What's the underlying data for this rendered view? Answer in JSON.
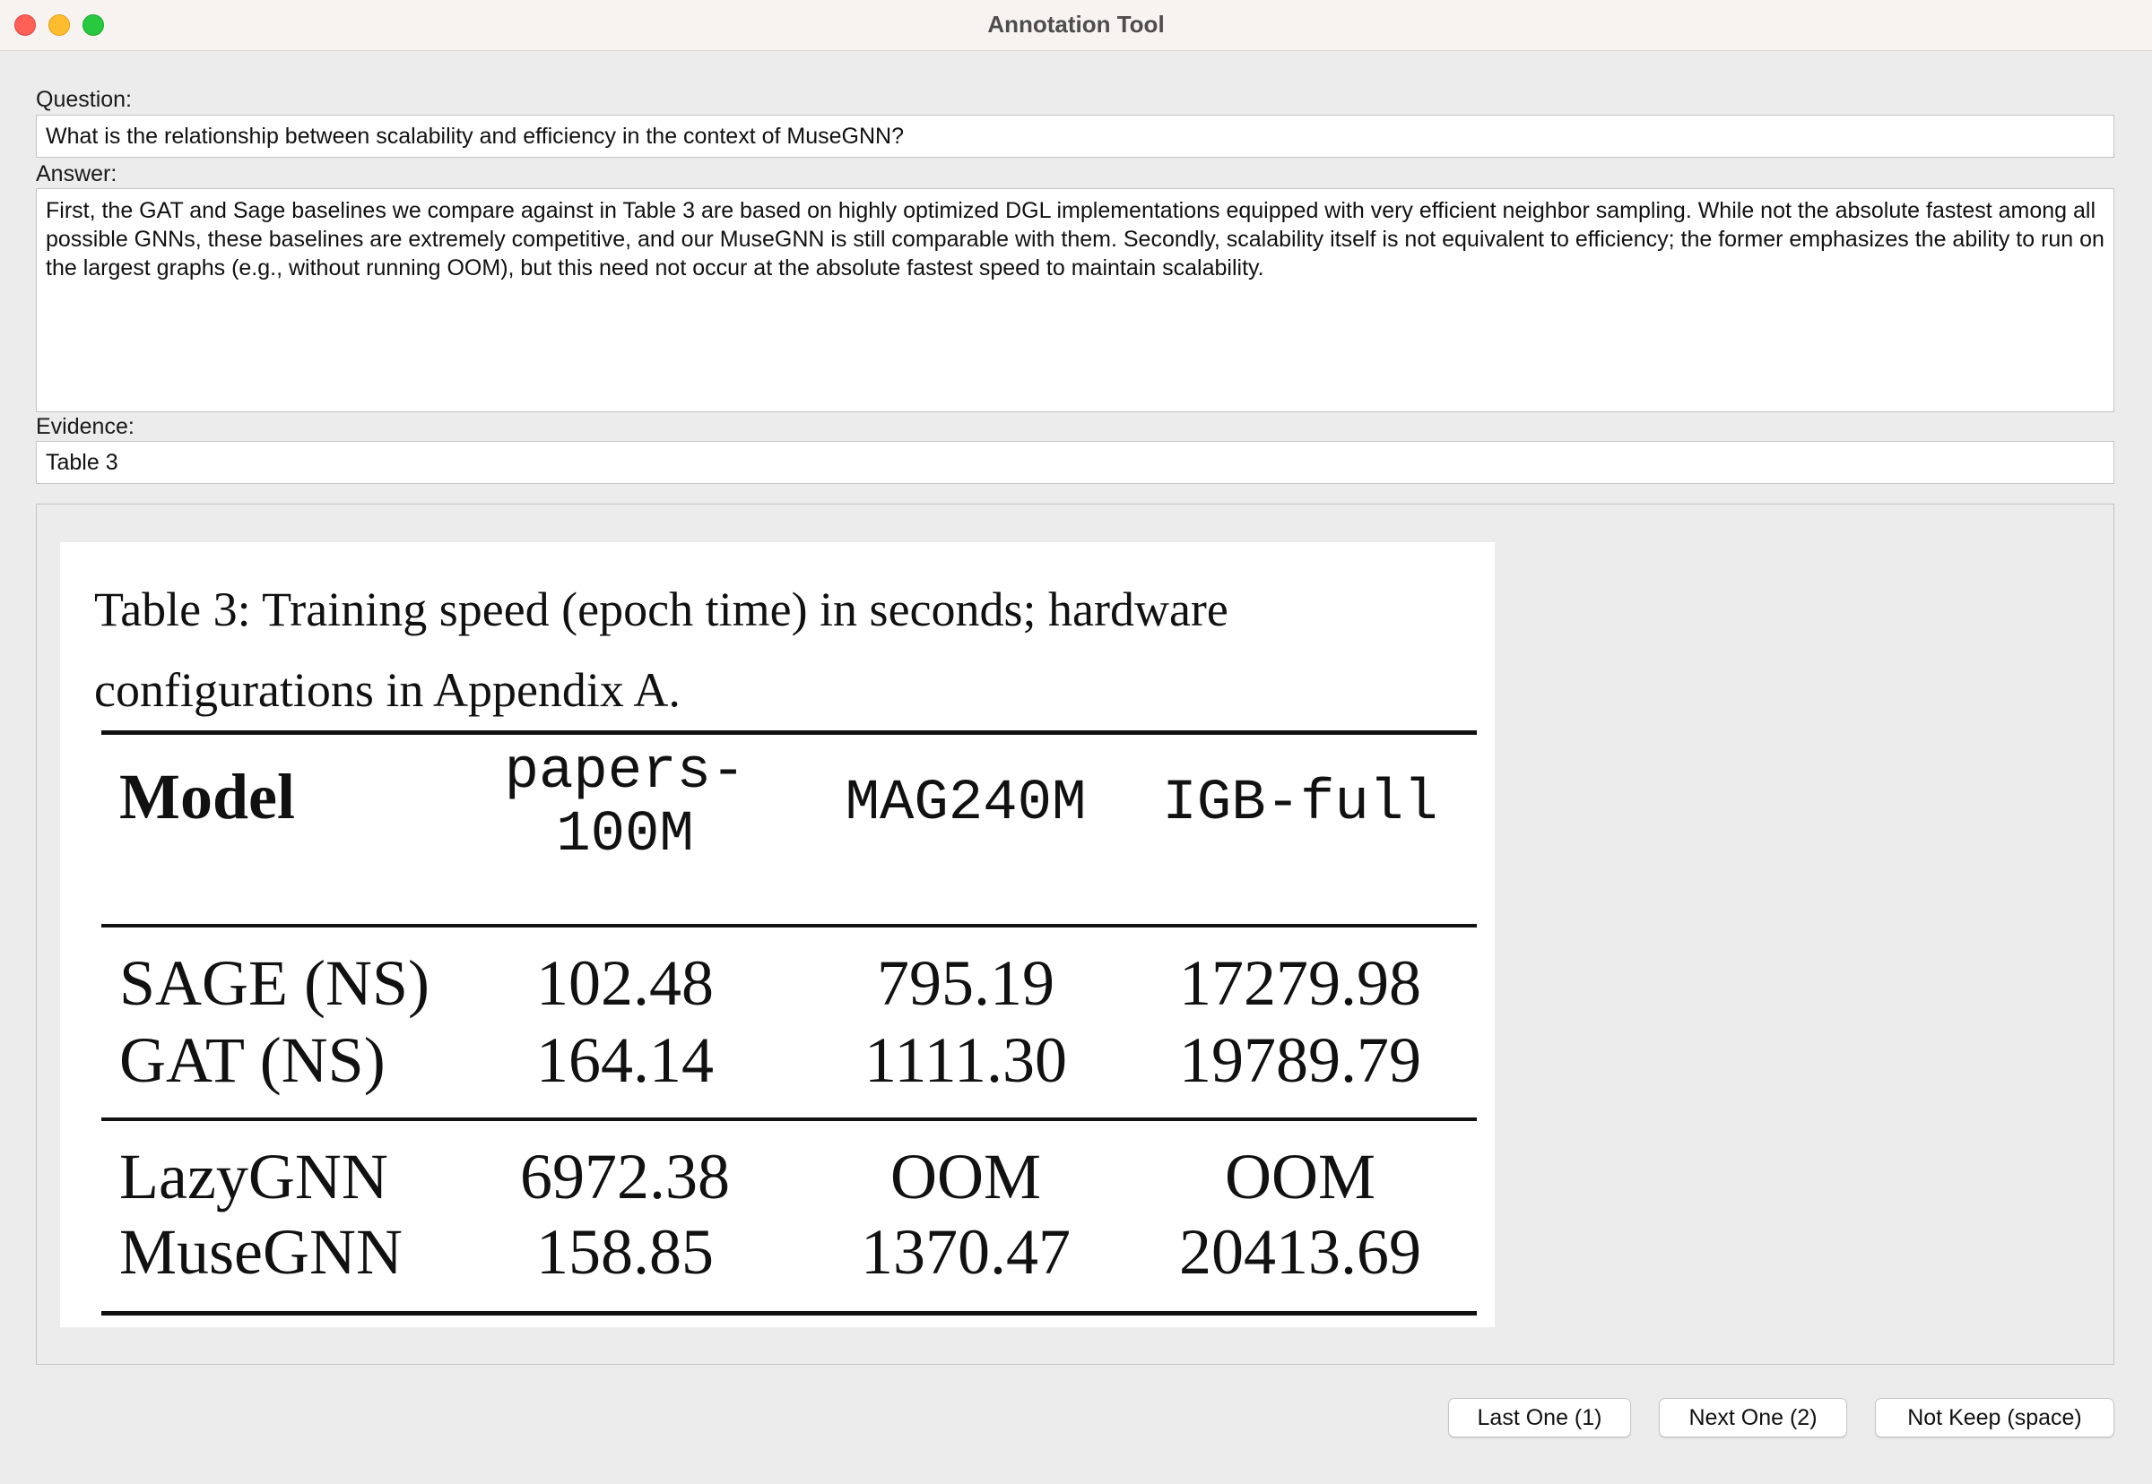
{
  "window": {
    "title": "Annotation Tool"
  },
  "form": {
    "question_label": "Question:",
    "question_value": "What is the relationship between scalability and efficiency in the context of MuseGNN?",
    "answer_label": "Answer:",
    "answer_value": "First, the GAT and Sage baselines we compare against in Table 3 are based on highly optimized DGL implementations equipped with very efficient neighbor sampling. While not the absolute fastest among all possible GNNs, these baselines are extremely competitive, and our MuseGNN is still comparable with them. Secondly, scalability itself is not equivalent to efficiency; the former emphasizes the ability to run on the largest graphs (e.g., without running OOM), but this need not occur at the absolute fastest speed to maintain scalability.",
    "evidence_label": "Evidence:",
    "evidence_value": "Table 3"
  },
  "evidence_image": {
    "caption_line1": "Table 3: Training speed (epoch time) in seconds; hardware",
    "caption_line2": "configurations in Appendix A.",
    "columns": [
      "Model",
      "papers-",
      "100M",
      "MAG240M",
      "IGB-full"
    ],
    "rows": [
      [
        "SAGE (NS)",
        "102.48",
        "795.19",
        "17279.98"
      ],
      [
        "GAT (NS)",
        "164.14",
        "1111.30",
        "19789.79"
      ],
      [
        "LazyGNN",
        "6972.38",
        "OOM",
        "OOM"
      ],
      [
        "MuseGNN",
        "158.85",
        "1370.47",
        "20413.69"
      ]
    ]
  },
  "buttons": {
    "last": "Last One (1)",
    "next": "Next One (2)",
    "not_keep": "Not Keep (space)"
  }
}
